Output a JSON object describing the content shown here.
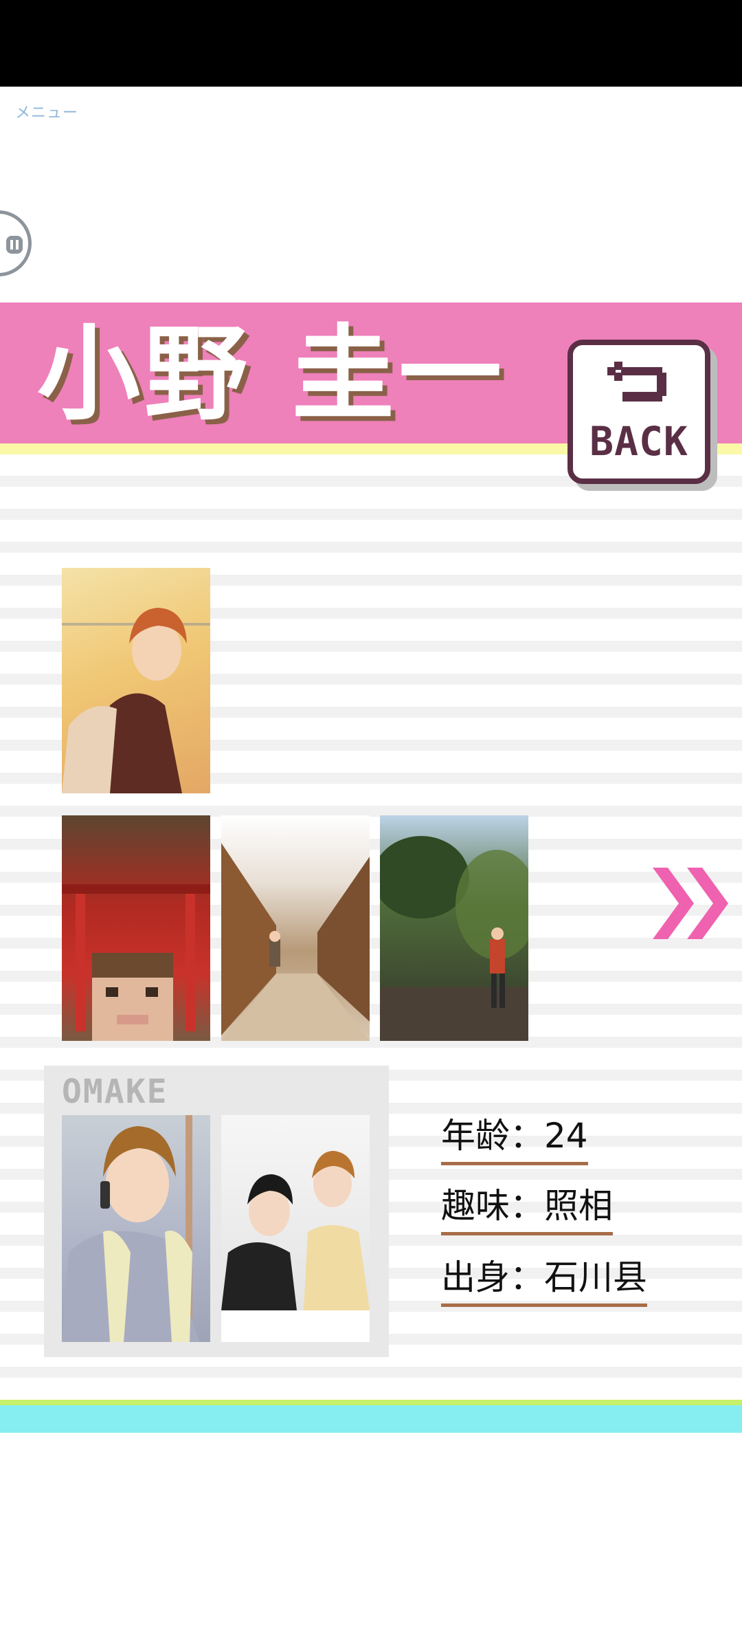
{
  "menu": {
    "label": "メニュー"
  },
  "character": {
    "name": "小野 圭一"
  },
  "back_button": {
    "label": "BACK"
  },
  "omake": {
    "title": "OMAKE"
  },
  "profile": {
    "age": "年龄：24",
    "hobby": "趣味：照相",
    "origin": "出身：石川县"
  },
  "colors": {
    "header_pink": "#ee80ba",
    "header_yellow": "#fbf8a8",
    "back_border": "#5a2f45",
    "arrow_pink": "#ef62b0",
    "underline_brown": "#a76d48",
    "footer_green": "#c6ef6a",
    "footer_cyan": "#86eef0"
  },
  "icons": {
    "pause": "pause-icon",
    "back_arrow": "return-arrow-icon",
    "next": "double-chevron-right-icon"
  }
}
